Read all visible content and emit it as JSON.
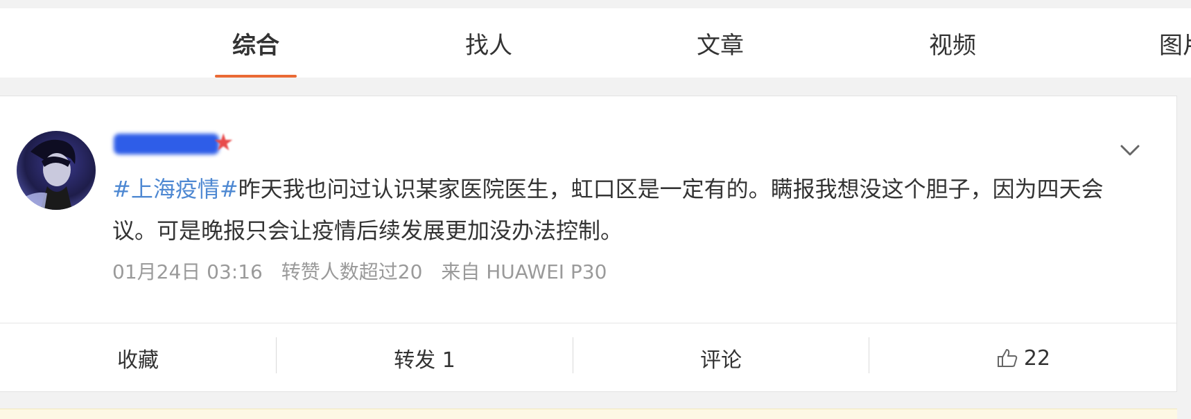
{
  "tabs": [
    {
      "label": "综合",
      "active": true
    },
    {
      "label": "找人",
      "active": false
    },
    {
      "label": "文章",
      "active": false
    },
    {
      "label": "视频",
      "active": false
    },
    {
      "label": "图片",
      "active": false
    }
  ],
  "colors": {
    "accent": "#ea6a35",
    "topic_link": "#4e88d2",
    "meta_text": "#9a9a9a"
  },
  "post": {
    "avatar_icon": "user-avatar",
    "expand_icon": "chevron-down-icon",
    "topic": "#上海疫情#",
    "body": "昨天我也问过认识某家医院医生，虹口区是一定有的。瞒报我想没这个胆子，因为四天会议。可是晚报只会让疫情后续发展更加没办法控制。",
    "date": "01月24日 03:16",
    "repost_note": "转赞人数超过20",
    "source": "来自 HUAWEI P30"
  },
  "actions": {
    "favorite": "收藏",
    "repost": "转发 1",
    "comment": "评论",
    "like_icon": "thumbs-up-icon",
    "like_count": "22"
  }
}
